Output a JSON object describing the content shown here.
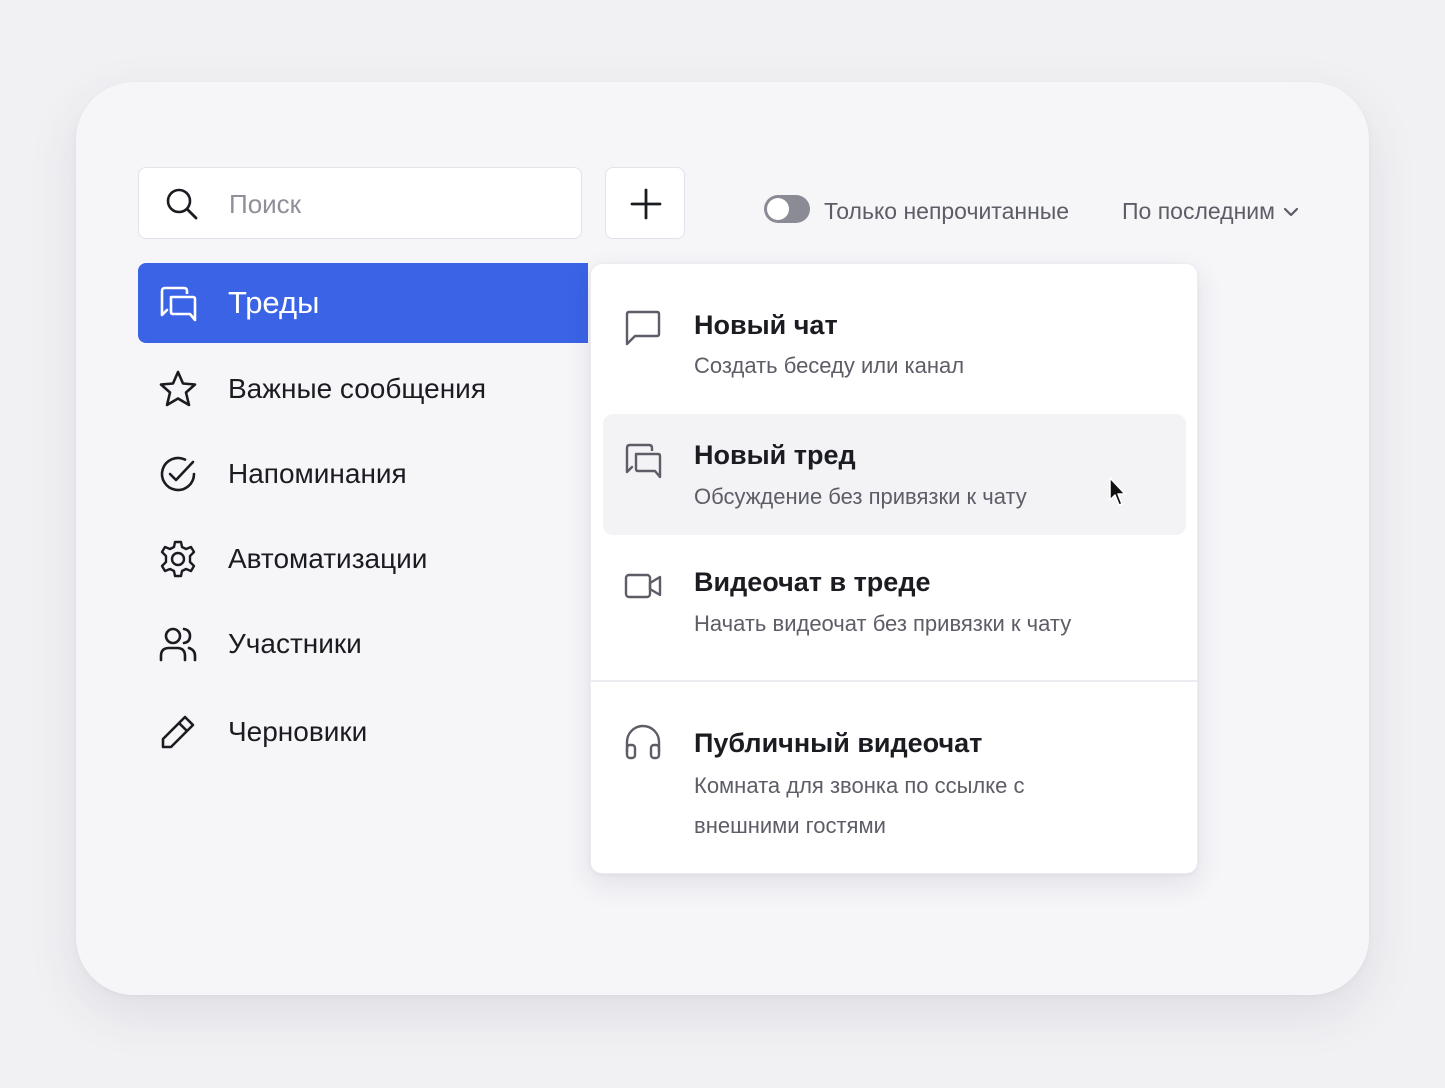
{
  "search": {
    "placeholder": "Поиск",
    "icon": "search-icon"
  },
  "toolbar": {
    "add_icon": "plus-icon",
    "toggle_label": "Только непрочитанные",
    "toggle_on": false,
    "sort_label": "По последним",
    "sort_icon": "chevron-down-icon"
  },
  "sidebar": {
    "items": [
      {
        "label": "Треды",
        "icon": "threads-icon",
        "active": true
      },
      {
        "label": "Важные сообщения",
        "icon": "star-icon"
      },
      {
        "label": "Напоминания",
        "icon": "check-circle-icon"
      },
      {
        "label": "Автоматизации",
        "icon": "gear-icon"
      },
      {
        "label": "Участники",
        "icon": "users-icon"
      },
      {
        "label": "Черновики",
        "icon": "pencil-icon"
      }
    ]
  },
  "menu": {
    "items": [
      {
        "title": "Новый чат",
        "desc": "Создать беседу или канал",
        "icon": "chat-bubble-icon"
      },
      {
        "title": "Новый тред",
        "desc": "Обсуждение без привязки к чату",
        "icon": "threads-icon",
        "hovered": true
      },
      {
        "title": "Видеочат в треде",
        "desc": "Начать видеочат без привязки к чату",
        "icon": "video-camera-icon"
      },
      {
        "title": "Публичный видеочат",
        "desc": "Комната для звонка по ссылке с внешними гостями",
        "icon": "headphones-icon"
      }
    ]
  },
  "colors": {
    "accent": "#3a63e6",
    "text": "#1b1c22",
    "muted": "#5c5d66",
    "card": "#f6f6f9"
  }
}
